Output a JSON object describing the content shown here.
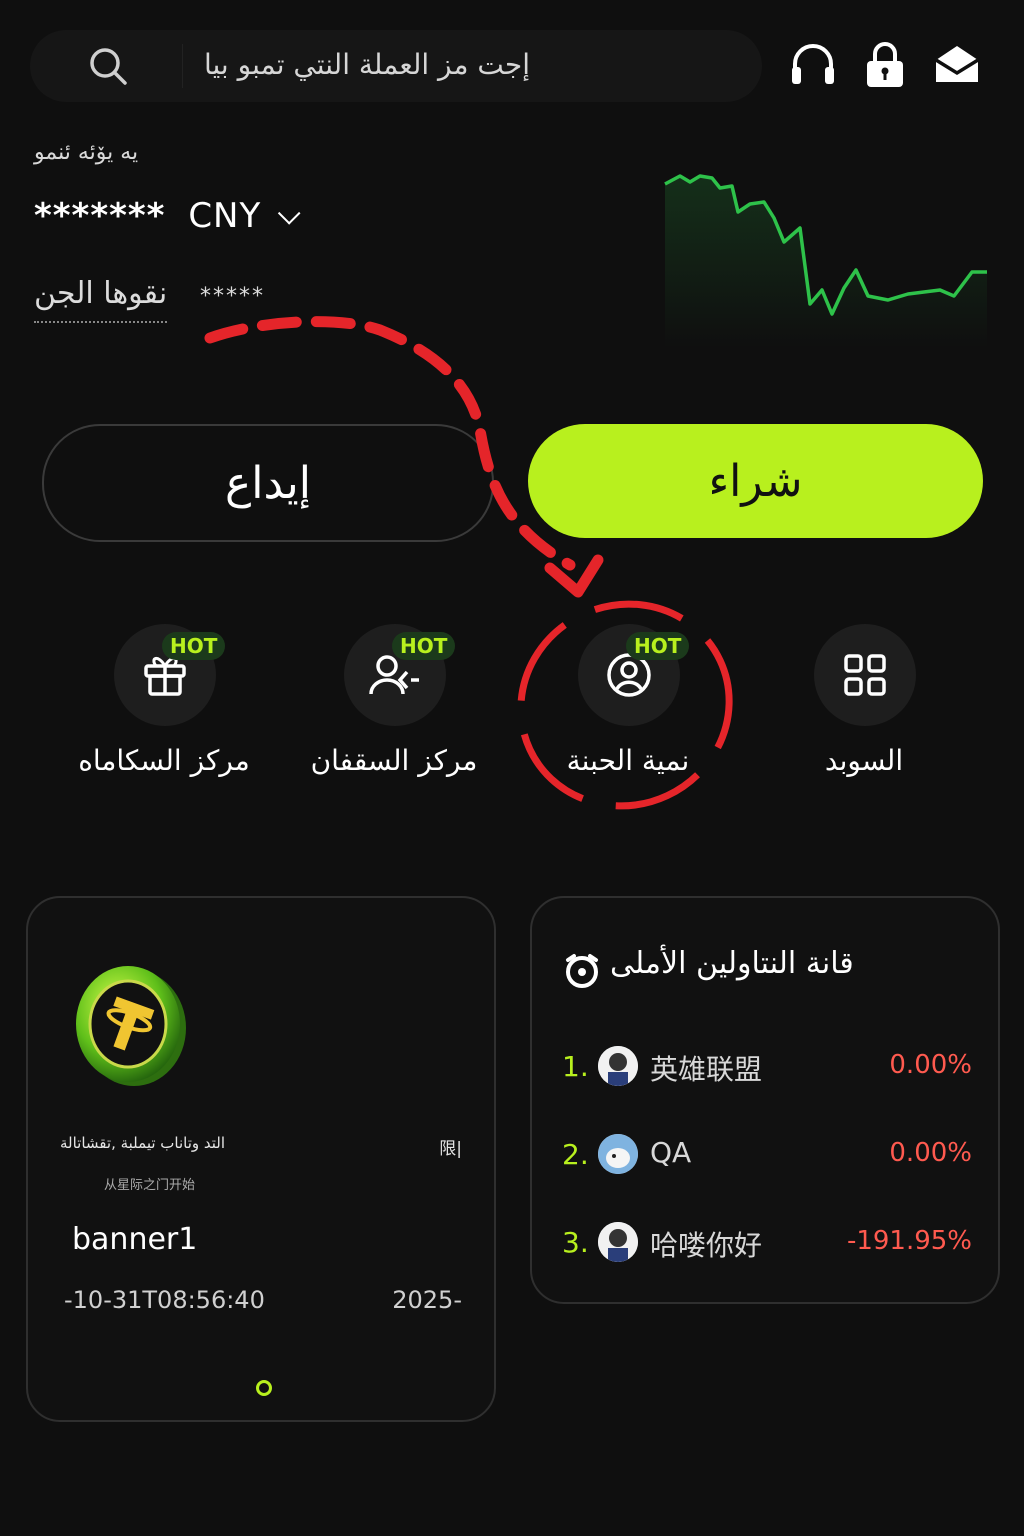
{
  "search": {
    "placeholder": "إجت مز العملة النتي تمبو بيا"
  },
  "header_icons": [
    "headset-icon",
    "lock-icon",
    "mail-icon"
  ],
  "account": {
    "label": "ﻳﻪ ﻳﯚﺋﻪ ﺋﻨﻤﻮ",
    "balance_masked": "*******",
    "currency": "CNY",
    "pnl_label": "نقوها الجن",
    "pnl_value": "*****"
  },
  "actions": {
    "deposit": "إيداع",
    "buy": "شراء"
  },
  "quick_actions": [
    {
      "label": "مركز السكاماه",
      "hot": "HOT",
      "icon": "gift-icon"
    },
    {
      "label": "مركز السقفان",
      "hot": "HOT",
      "icon": "users-icon"
    },
    {
      "label": "نمية الحبنة",
      "hot": "HOT",
      "icon": "user-circle-icon"
    },
    {
      "label": "السوبد",
      "hot": "",
      "icon": "grid-icon"
    }
  ],
  "banner": {
    "text_ar": "التد وتاناب تيملبة ,تقشاتالة",
    "text_cjk": "限|",
    "subtitle": "从星际之门开始",
    "title": "banner1",
    "date_left": "-10-31T08:56:40",
    "date_right": "2025-"
  },
  "leaderboard": {
    "title": "قانة النتاولين الأملى",
    "rows": [
      {
        "rank": "1.",
        "name": "英雄联盟",
        "pct": "0.00%"
      },
      {
        "rank": "2.",
        "name": "QA",
        "pct": "0.00%"
      },
      {
        "rank": "3.",
        "name": "哈喽你好",
        "pct": "-191.95%"
      }
    ]
  },
  "colors": {
    "accent": "#b8f01e",
    "negative": "#ff5a4f",
    "spark": "#2ec24a",
    "annotation": "#e5252a"
  }
}
